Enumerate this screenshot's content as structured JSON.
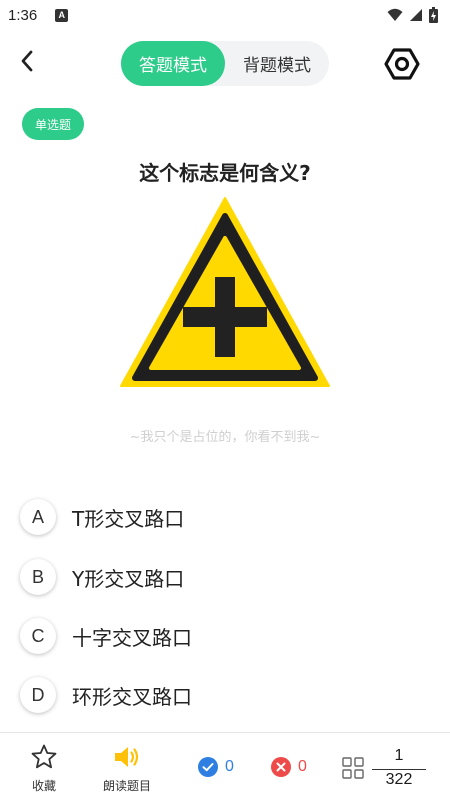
{
  "status_bar": {
    "time": "1:36",
    "app_icon_letter": "A"
  },
  "header": {
    "modes": [
      {
        "label": "答题模式",
        "active": true
      },
      {
        "label": "背题模式",
        "active": false
      }
    ]
  },
  "question": {
    "type_badge": "单选题",
    "title": "这个标志是何含义?",
    "image": "warning-sign-crossroads",
    "placeholder_text": "~我只个是占位的，你看不到我~"
  },
  "options": [
    {
      "letter": "A",
      "text": "T形交叉路口"
    },
    {
      "letter": "B",
      "text": "Y形交叉路口"
    },
    {
      "letter": "C",
      "text": "十字交叉路口"
    },
    {
      "letter": "D",
      "text": "环形交叉路口"
    }
  ],
  "bottom_bar": {
    "favorite_label": "收藏",
    "read_aloud_label": "朗读题目",
    "correct_count": "0",
    "wrong_count": "0",
    "current_index": "1",
    "total": "322"
  },
  "colors": {
    "accent": "#2ecc8a",
    "correct": "#2f7fe3",
    "wrong": "#ef4a4a",
    "sign_yellow": "#ffd900"
  }
}
